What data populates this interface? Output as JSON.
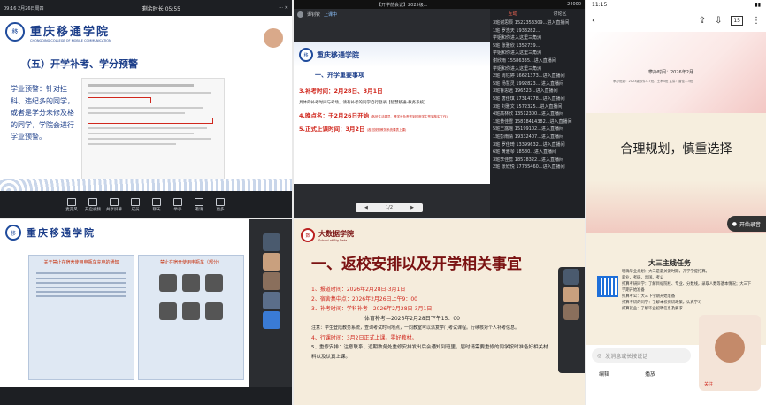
{
  "p1": {
    "topbar": {
      "time": "09:16 2月26日周四",
      "title": "剩余时长 05:55"
    },
    "header": {
      "school_cn": "重庆移通学院",
      "school_en": "CHONGQING COLLEGE OF MOBILE COMMUNICATION"
    },
    "slide_title": "（五）开学补考、学分预警",
    "warning_text": "学业预警：针对挂科、违纪多的同学，或者是学分未修及格的同学，学院会进行学业预警。",
    "toolbar": [
      "麦克风",
      "开启视频",
      "共享屏幕",
      "成员",
      "聊天",
      "举手",
      "邀请",
      "更多"
    ],
    "badge": "1"
  },
  "p2": {
    "topbar": {
      "title": "【开学前会议】2025级...",
      "count": "24000"
    },
    "speaker": "谭钊钦",
    "sharing": "上课中",
    "slide_heading": "一、开学重要事项",
    "items": [
      {
        "label": "3.补考时间：",
        "value": "2月28日、3月1日"
      },
      {
        "label": "",
        "value": "具体的补考时间与考场，请有补考的同学自行登录【智慧移通-教务系统】"
      },
      {
        "label": "4.晚点名：",
        "value": "于2月26日开始",
        "note": "(各班生活委员、晋学长负责签到回座学生签到核实工作)"
      },
      {
        "label": "5.正式上课时间：",
        "value": "3月2日",
        "note": "(各班按照教务系统课表上课)"
      }
    ],
    "page": "1/2",
    "tabs": [
      "互动",
      "讨论区"
    ],
    "chat": [
      "3班谢思辰 1522353309...进入直播间",
      "1班 罗浩天 1933282...",
      "学姐和你进入这里三角洲",
      "5班 张雅欣 1352739...",
      "学姐和你进入这里三角洲",
      "谢欣雨 15586335...进入直播间",
      "学姐和你进入这里三角洲",
      "2班 周钰婷 16621373...进入直播间",
      "5班 杨慧灵 1992823... 进入直播间",
      "3班鲁思远 196523...进入直播间",
      "5班 唐佳琪 17314778...进入直播间",
      "3班 刘雅文 1572325...进入直播间",
      "4班高林欣 13512300...进入直播间",
      "1班黄佳雪 15818414382...进入直播间",
      "5班王露瑶 15199102...进入直播间",
      "1班彭雨倩 19332407...进入直播间",
      "3班 罗佳琦 13399632...进入直播间",
      "6班 黄雅琴 18580...进入直播间",
      "3班李佳蕊 18578322...进入直播间",
      "2班 张欣悦 17785460...进入直播间"
    ]
  },
  "p3": {
    "status": {
      "time": "11:15"
    },
    "page_count": "15",
    "header_text": "攀办时间：2026年2月",
    "sub_text": "承办班级：2023级软件4-7班、土木4班 主讲：曾佳1-3班",
    "big_title": "合理规划，慎重选择",
    "section_title": "大三主线任务",
    "lines": [
      "明确毕业规划：大三是最关键时期，开学学提打算。",
      "就业、考研、出国、考公",
      "打算考研同学：了解目标院校、专业、分数线，录取人数等基本情况；大三下学期开始准备",
      "打算考公：大三下学期开始准备",
      "打算考研的同学：了解本校保研政策，认真学习",
      "打算就业：了解毕业招聘信息及要求"
    ],
    "voice_btn": "开始录音",
    "input_placeholder": "发消息或长按说话",
    "bottom": [
      "编辑",
      "播放"
    ],
    "follow": "关注"
  },
  "p4": {
    "header": {
      "school_cn": "重庆移通学院"
    },
    "notice1_title": "关于禁止在宿舍使用电瓶车充电的通知",
    "notice2_title": "禁止在宿舍使用电瓶车（部分）"
  },
  "p5": {
    "school": "大数据学院",
    "school_en": "School of Big Data",
    "title": "一、返校安排以及开学相关事宜",
    "items": [
      "1、报道时间：2026年2月28日-3月1日",
      "2、宿舍集中点：2026年2月26日上午9：00",
      "3、补考时间：学科补考—2026年2月28日-3月1日",
      "体育补考—2026年2月28日下午15：00",
      "注意：学生登陆教务系统，查询考试时间地点，一同教室可以派复学门考试课程。行续核对个人补考信息。",
      "4、行课时间：3月2日正式上课，零好教材。",
      "5、重修安排：注意联系、近期教务处重修安排发出后会通知到班里，届时请需要重修的同学按时准备好相关材料以及认真上课。"
    ]
  },
  "colors": {
    "accent_red": "#d0271d",
    "navy": "#1d3f8a",
    "dark_bg": "#1d1f23"
  }
}
